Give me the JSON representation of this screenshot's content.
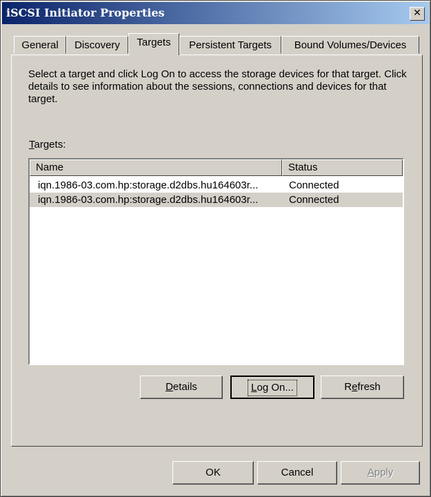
{
  "window": {
    "title": "iSCSI Initiator Properties",
    "close_glyph": "✕"
  },
  "tabs": [
    {
      "label": "General"
    },
    {
      "label": "Discovery"
    },
    {
      "label": "Targets"
    },
    {
      "label": "Persistent Targets"
    },
    {
      "label": "Bound Volumes/Devices"
    }
  ],
  "active_tab": "Targets",
  "targets_tab": {
    "description": "Select a target and click Log On to access the storage devices for that target. Click details to see information about the sessions, connections and devices for that target.",
    "targets_label": "Targets:",
    "columns": {
      "name": "Name",
      "status": "Status"
    },
    "rows": [
      {
        "name": "iqn.1986-03.com.hp:storage.d2dbs.hu164603r...",
        "status": "Connected"
      },
      {
        "name": "iqn.1986-03.com.hp:storage.d2dbs.hu164603r...",
        "status": "Connected"
      }
    ],
    "buttons": {
      "details": "Details",
      "log_on": "Log On...",
      "refresh": "Refresh"
    }
  },
  "footer": {
    "ok": "OK",
    "cancel": "Cancel",
    "apply": "Apply"
  }
}
